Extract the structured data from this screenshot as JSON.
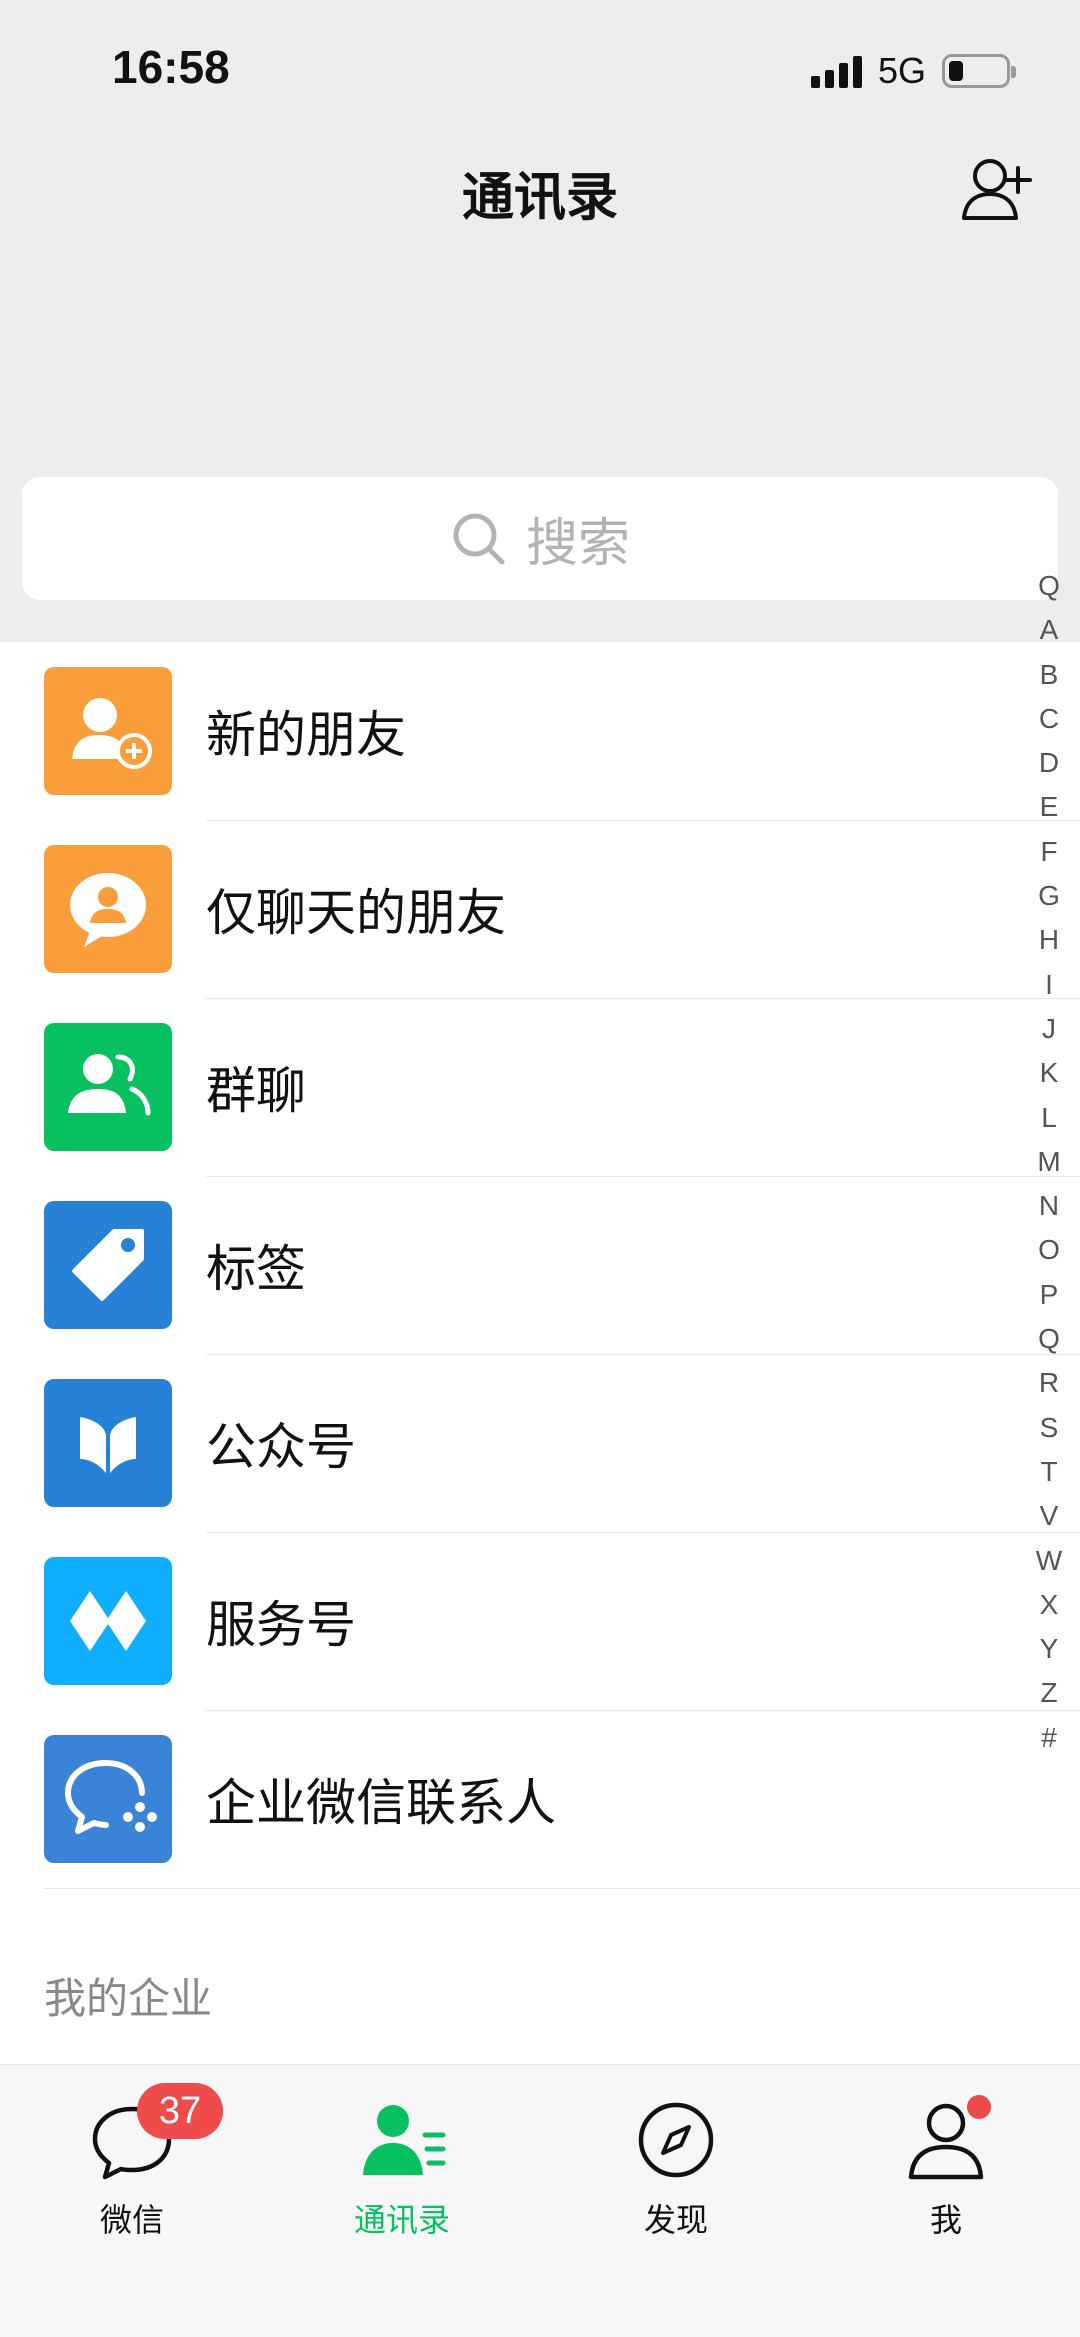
{
  "status": {
    "time": "16:58",
    "network": "5G"
  },
  "header": {
    "title": "通讯录"
  },
  "search": {
    "placeholder": "搜索"
  },
  "items": [
    {
      "label": "新的朋友",
      "color": "#fa9d3b",
      "icon": "add-friend-icon"
    },
    {
      "label": "仅聊天的朋友",
      "color": "#fa9d3b",
      "icon": "chat-only-friend-icon"
    },
    {
      "label": "群聊",
      "color": "#07c160",
      "icon": "group-chat-icon"
    },
    {
      "label": "标签",
      "color": "#2782d7",
      "icon": "tag-icon"
    },
    {
      "label": "公众号",
      "color": "#2782d7",
      "icon": "official-account-icon"
    },
    {
      "label": "服务号",
      "color": "#10aeff",
      "icon": "service-account-icon"
    },
    {
      "label": "企业微信联系人",
      "color": "#3b83d6",
      "icon": "wecom-contact-icon"
    }
  ],
  "section": {
    "my_enterprise": "我的企业"
  },
  "index": [
    "Q",
    "A",
    "B",
    "C",
    "D",
    "E",
    "F",
    "G",
    "H",
    "I",
    "J",
    "K",
    "L",
    "M",
    "N",
    "O",
    "P",
    "Q",
    "R",
    "S",
    "T",
    "V",
    "W",
    "X",
    "Y",
    "Z",
    "#"
  ],
  "tabs": [
    {
      "label": "微信",
      "badge": "37",
      "active": false
    },
    {
      "label": "通讯录",
      "active": true
    },
    {
      "label": "发现",
      "active": false
    },
    {
      "label": "我",
      "dot": true,
      "active": false
    }
  ],
  "colors": {
    "accent": "#07c160",
    "badge": "#f04b4b"
  }
}
